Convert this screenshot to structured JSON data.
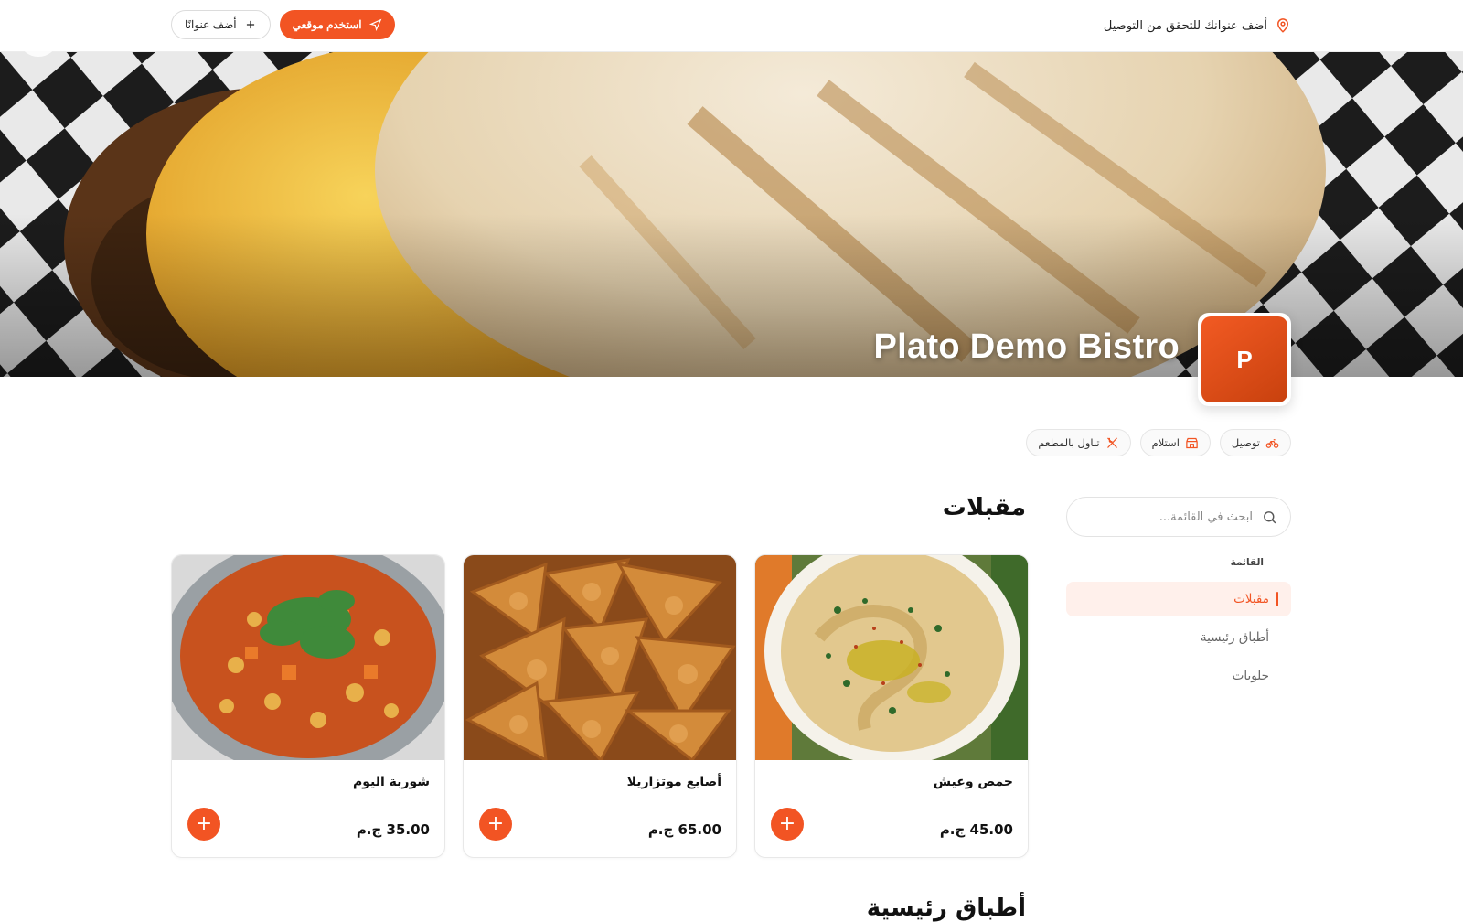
{
  "header": {
    "address_prompt": "أضف عنوانك للتحقق من التوصيل",
    "use_location_label": "استخدم موقعي",
    "add_address_label": "أضف عنوانًا",
    "accent_color": "#f25423"
  },
  "restaurant": {
    "name": "Plato Demo Bistro",
    "logo_letter": "P"
  },
  "services": [
    {
      "label": "توصيل",
      "icon": "bike-icon"
    },
    {
      "label": "استلام",
      "icon": "store-icon"
    },
    {
      "label": "تناول بالمطعم",
      "icon": "utensils-icon"
    }
  ],
  "sidebar": {
    "search_placeholder": "ابحث في القائمة...",
    "menu_heading": "القائمة",
    "categories": [
      {
        "label": "مقبلات",
        "active": true
      },
      {
        "label": "أطباق رئيسية",
        "active": false
      },
      {
        "label": "حلويات",
        "active": false
      }
    ]
  },
  "section": {
    "title": "مقبلات",
    "items": [
      {
        "name": "حمص وعيش",
        "price": "45.00 ج.م",
        "image": "hummus-image"
      },
      {
        "name": "أصابع موتزاريلا",
        "price": "65.00 ج.م",
        "image": "pastry-image"
      },
      {
        "name": "شوربة اليوم",
        "price": "35.00 ج.م",
        "image": "soup-image"
      }
    ],
    "add_symbol": "+"
  },
  "next_section": {
    "title": "أطباق رئيسية"
  }
}
